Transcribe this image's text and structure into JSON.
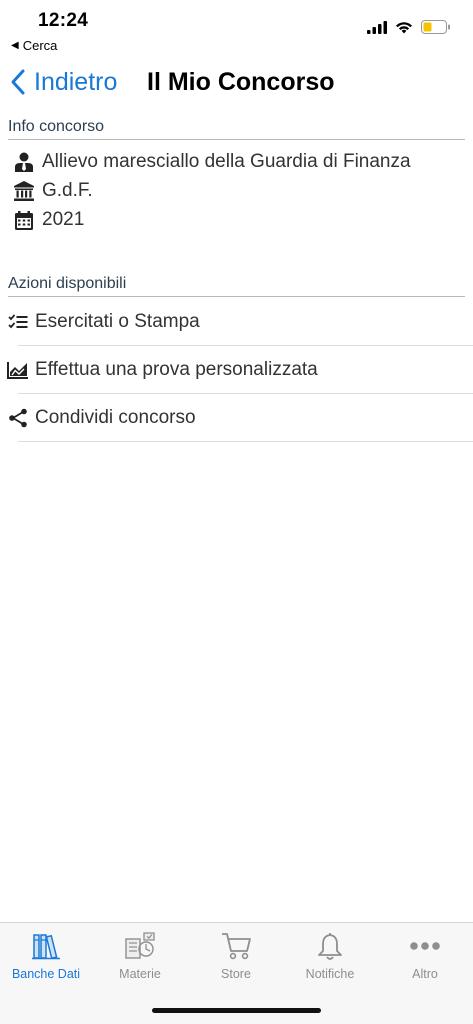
{
  "status_bar": {
    "time": "12:24",
    "back_app_label": "Cerca",
    "back_app_icon": "triangle-left-icon",
    "battery_color": "#f5c400"
  },
  "nav": {
    "back_label": "Indietro",
    "title": "Il Mio Concorso",
    "accent_color": "#1a78d6"
  },
  "info_section": {
    "header": "Info concorso",
    "items": [
      {
        "icon": "user-tie-icon",
        "text": "Allievo maresciallo della Guardia di Finanza"
      },
      {
        "icon": "institution-icon",
        "text": "G.d.F."
      },
      {
        "icon": "calendar-icon",
        "text": "2021"
      }
    ]
  },
  "actions_section": {
    "header": "Azioni disponibili",
    "items": [
      {
        "icon": "checklist-icon",
        "text": "Esercitati o Stampa"
      },
      {
        "icon": "area-chart-icon",
        "text": "Effettua una prova personalizzata"
      },
      {
        "icon": "share-icon",
        "text": "Condividi concorso"
      }
    ]
  },
  "tab_bar": {
    "active": "Banche Dati",
    "tabs": [
      {
        "icon": "books-icon",
        "label": "Banche Dati"
      },
      {
        "icon": "subjects-icon",
        "label": "Materie"
      },
      {
        "icon": "cart-icon",
        "label": "Store"
      },
      {
        "icon": "bell-icon",
        "label": "Notifiche"
      },
      {
        "icon": "more-dots-icon",
        "label": "Altro"
      }
    ]
  }
}
